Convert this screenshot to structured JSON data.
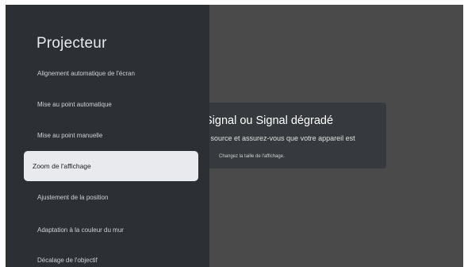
{
  "sidebar": {
    "title": "Projecteur",
    "items": [
      {
        "label": "Alignement automatique de l'écran"
      },
      {
        "label": "Mise au point automatique"
      },
      {
        "label": "Mise au point manuelle"
      },
      {
        "label": "Zoom de l'affichage",
        "selected": true
      },
      {
        "label": "Ajustement de la position"
      },
      {
        "label": "Adaptation à la couleur du mur"
      },
      {
        "label": "Décalage de l'objectif"
      }
    ]
  },
  "dialog": {
    "title": "Signal ou Signal dégradé",
    "message": "e source et assurez-vous que votre appareil est",
    "hint": "Changez la taille de l'affichage."
  },
  "colors": {
    "sidebar_bg": "#2c3035",
    "screen_bg": "#4a4a4a",
    "selected_bg": "#e8eaed",
    "dialog_bg": "#36393d"
  }
}
